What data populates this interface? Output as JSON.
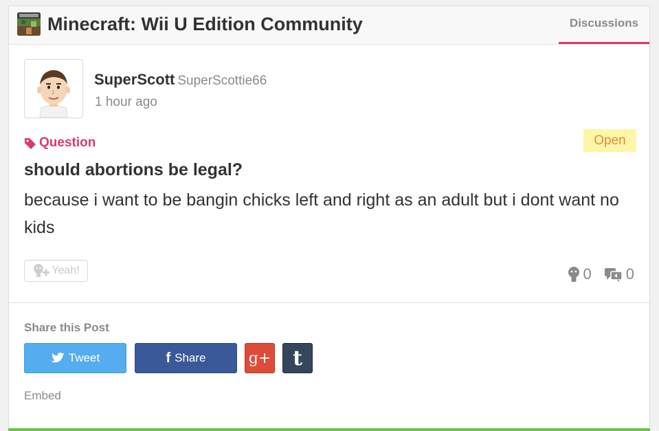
{
  "header": {
    "community_title": "Minecraft: Wii U Edition Community",
    "tab_label": "Discussions",
    "accent_color": "#d93a6e"
  },
  "post": {
    "username": "SuperScott",
    "user_id": "SuperScottie66",
    "timestamp": "1 hour ago",
    "tag": "Question",
    "status": "Open",
    "title": "should abortions be legal?",
    "body": "because i want to be bangin chicks left and right as an adult but i dont want no kids",
    "yeah_label": "Yeah!",
    "yeah_count": "0",
    "reply_count": "0"
  },
  "share": {
    "heading": "Share this Post",
    "tweet_label": "Tweet",
    "facebook_label": "Share",
    "gplus_glyph": "g+",
    "tumblr_glyph": "t",
    "embed_label": "Embed",
    "colors": {
      "twitter": "#55acee",
      "facebook": "#3b5998",
      "gplus": "#dd4b39",
      "tumblr": "#35465c"
    }
  },
  "icons": [
    "minecraft-community-icon",
    "mii-avatar",
    "tag-icon",
    "yeah-icon",
    "empathy-icon",
    "reply-icon",
    "twitter-bird-icon",
    "facebook-f-icon"
  ]
}
